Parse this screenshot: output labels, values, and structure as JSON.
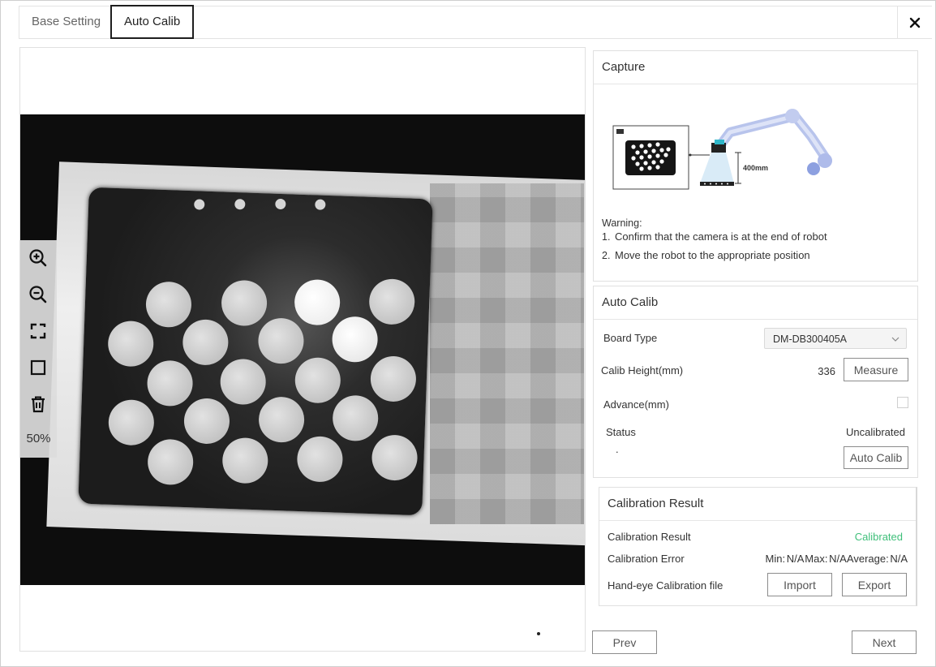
{
  "tabs": [
    {
      "label": "Base Setting",
      "active": false
    },
    {
      "label": "Auto Calib",
      "active": true
    }
  ],
  "viewer": {
    "zoom_level": "50%",
    "tools": [
      "zoom-in-icon",
      "zoom-out-icon",
      "fit-screen-icon",
      "select-rect-icon",
      "delete-icon"
    ]
  },
  "capture": {
    "title": "Capture",
    "illustration_distance": "400mm",
    "warning_title": "Warning:",
    "warnings": [
      {
        "num": "1.",
        "text": "Confirm that the camera is at the end of robot"
      },
      {
        "num": "2.",
        "text": "Move the robot to the appropriate position"
      }
    ]
  },
  "auto_calib": {
    "title": "Auto Calib",
    "board_type_label": "Board Type",
    "board_type_value": "DM-DB300405A",
    "calib_height_label": "Calib Height(mm)",
    "calib_height_value": "336",
    "measure_label": "Measure",
    "advance_label": "Advance(mm)",
    "advance_checked": false,
    "status_label": "Status",
    "status_value": "Uncalibrated",
    "status_detail": ".",
    "auto_calib_button": "Auto Calib"
  },
  "calibration_result": {
    "title": "Calibration Result",
    "result_label": "Calibration Result",
    "result_value": "Calibrated",
    "error_label": "Calibration Error",
    "error_value": "Min: N/A  Max: N/A  Average: N/A",
    "file_label": "Hand-eye Calibration file",
    "import_label": "Import",
    "export_label": "Export"
  },
  "footer": {
    "prev_label": "Prev",
    "next_label": "Next"
  },
  "colors": {
    "success": "#3fbf7a",
    "active_tab_border": "#1e1e1e"
  }
}
